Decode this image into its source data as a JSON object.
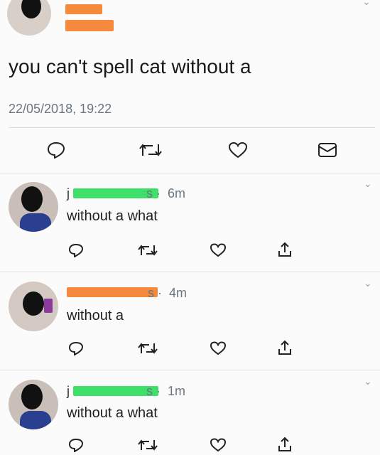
{
  "main_tweet": {
    "text": "you can't spell cat without a",
    "timestamp": "22/05/2018, 19:22",
    "actions": [
      "reply-icon",
      "retweet-icon",
      "like-icon",
      "direct-message-icon"
    ]
  },
  "replies": [
    {
      "time": "6m",
      "text": "without a what",
      "redaction_color": "#3ee06a"
    },
    {
      "time": "4m",
      "text": "without a",
      "redaction_color": "#f58a3c"
    },
    {
      "time": "1m",
      "text": "without a what",
      "redaction_color": "#3ee06a"
    }
  ],
  "reply_actions": [
    "reply-icon",
    "retweet-icon",
    "like-icon",
    "share-icon"
  ],
  "colors": {
    "main_redaction": "#f58a3c",
    "icon": "#222222",
    "muted_text": "#6b7680"
  }
}
